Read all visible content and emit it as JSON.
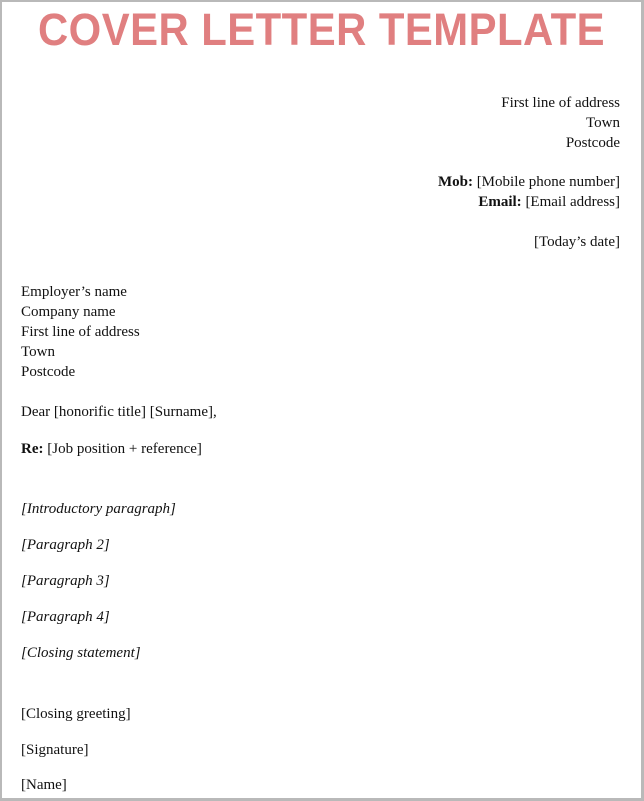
{
  "title": "COVER LETTER TEMPLATE",
  "colors": {
    "title": "#e07f80",
    "text": "#111111",
    "border": "#b9b9b9"
  },
  "sender": {
    "address_line1": "First line of address",
    "town": "Town",
    "postcode": "Postcode",
    "mob_label": "Mob:",
    "mob_value": "[Mobile phone number]",
    "email_label": "Email:",
    "email_value": "[Email address]",
    "date": "[Today’s date]"
  },
  "recipient": {
    "employer_name": "Employer’s name",
    "company_name": "Company name",
    "address_line1": "First line of address",
    "town": "Town",
    "postcode": "Postcode"
  },
  "salutation": "Dear [honorific title] [Surname],",
  "re_label": "Re:",
  "re_value": "[Job position + reference]",
  "paragraphs": [
    "[Introductory paragraph]",
    "[Paragraph 2]",
    "[Paragraph 3]",
    "[Paragraph 4]",
    "[Closing statement]"
  ],
  "closing": {
    "greeting": "[Closing greeting]",
    "signature": "[Signature]",
    "name": "[Name]"
  }
}
